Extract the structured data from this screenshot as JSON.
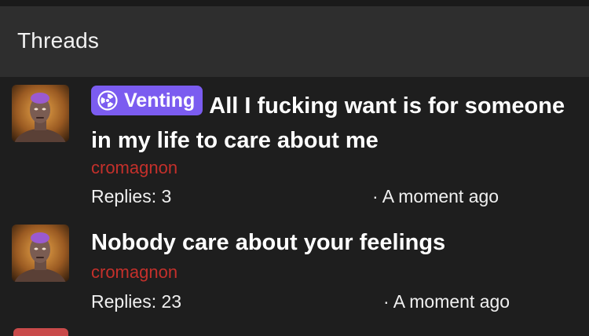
{
  "header": {
    "title": "Threads"
  },
  "threads": [
    {
      "badge": {
        "label": "Venting",
        "icon": "radiation-icon",
        "color": "#7b5cf0"
      },
      "title": "All I fucking want is for someone in my life to care about me",
      "author": "cromagnon",
      "replies": "Replies: 3",
      "time": "· A moment ago"
    },
    {
      "title": "Nobody care about your feelings",
      "author": "cromagnon",
      "replies": "Replies: 23",
      "time": "· A moment ago"
    }
  ],
  "colors": {
    "background": "#1e1e1e",
    "header": "#2e2e2e",
    "author": "#c4302b",
    "badge": "#7b5cf0"
  }
}
